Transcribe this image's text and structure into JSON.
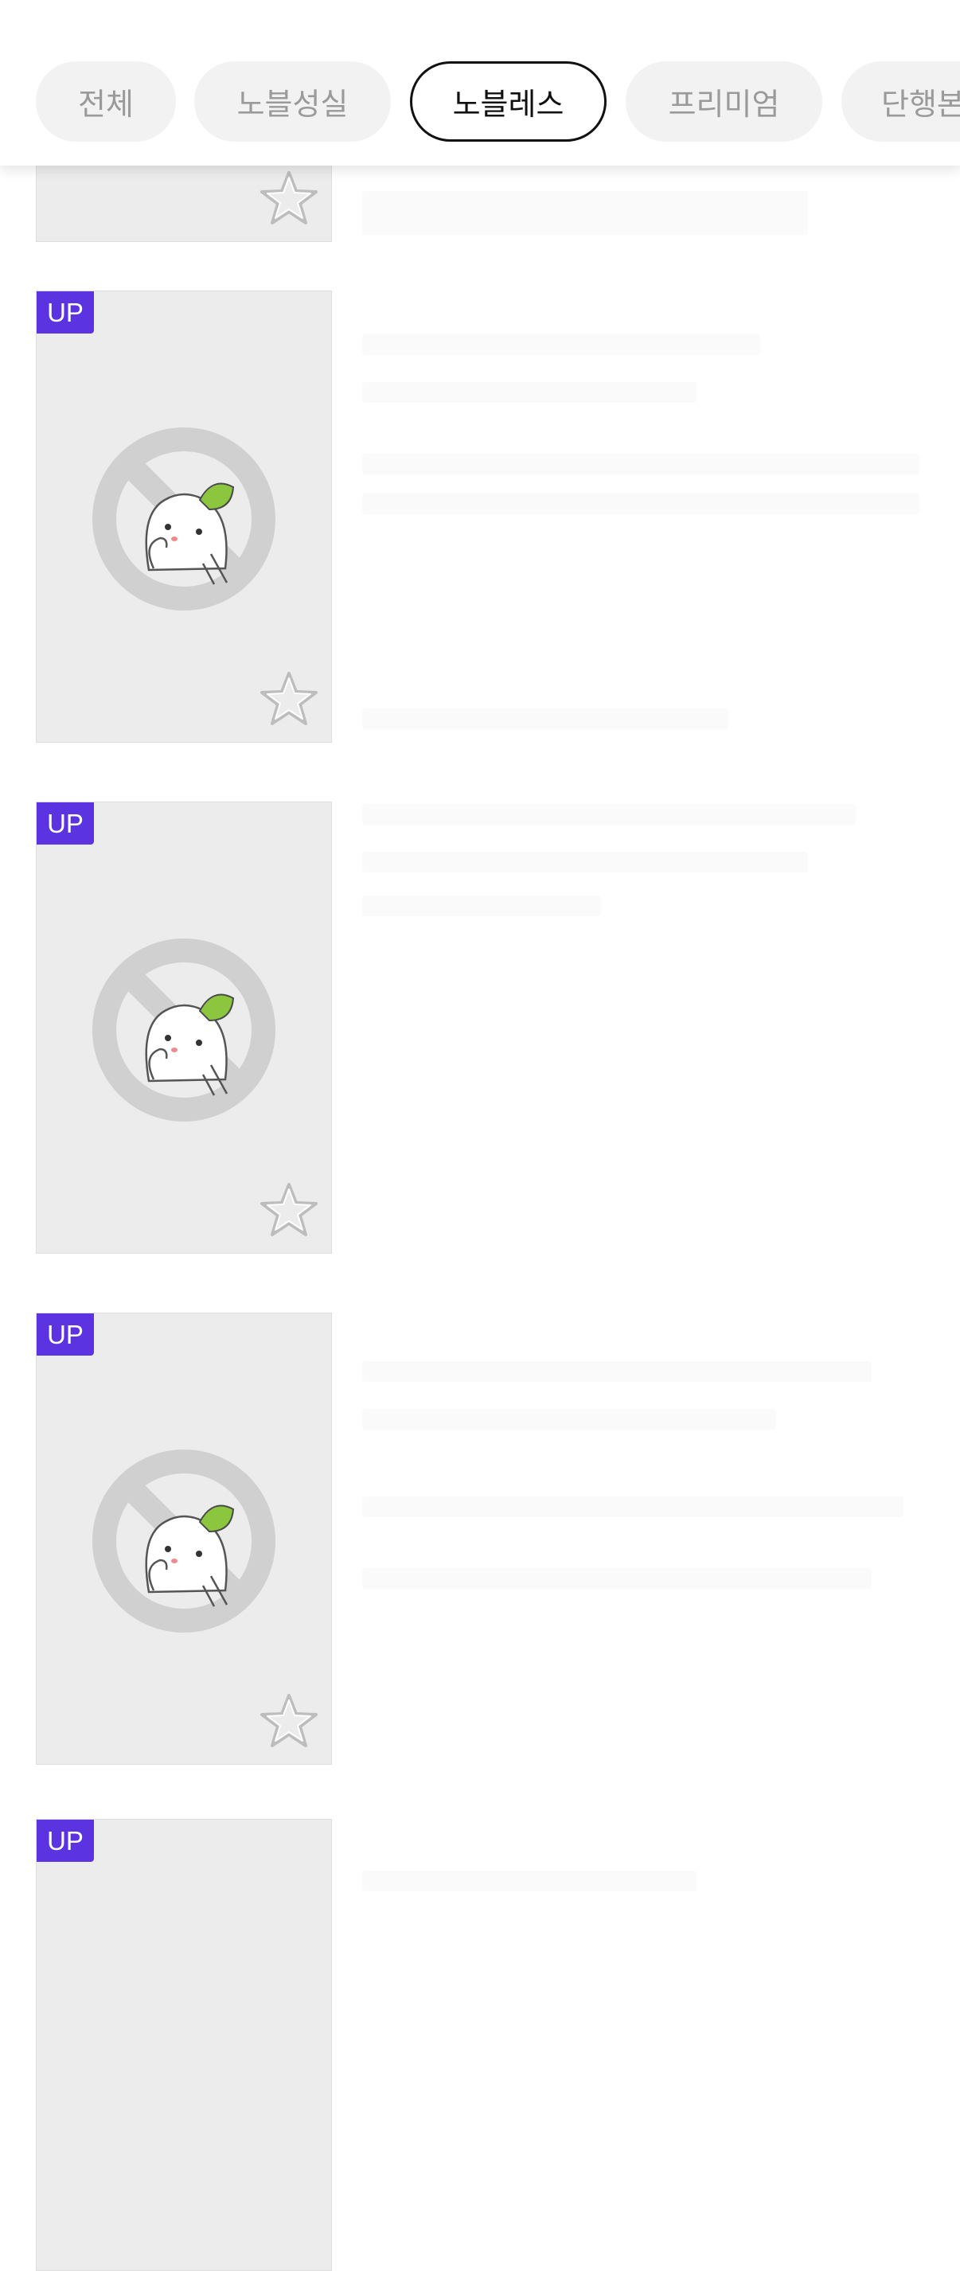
{
  "tabs": [
    {
      "label": "전체",
      "active": false
    },
    {
      "label": "노블성실",
      "active": false
    },
    {
      "label": "노블레스",
      "active": true
    },
    {
      "label": "프리미엄",
      "active": false
    },
    {
      "label": "단행본",
      "active": false
    }
  ],
  "list": {
    "badge_label": "UP",
    "favorite_icon": "star-outline-icon",
    "cover_icon": "no-image-placeholder-icon"
  },
  "colors": {
    "badge": "#5b33e0",
    "card_bg": "#ececec",
    "tab_bg": "#f2f2f2",
    "active_border": "#111111"
  }
}
